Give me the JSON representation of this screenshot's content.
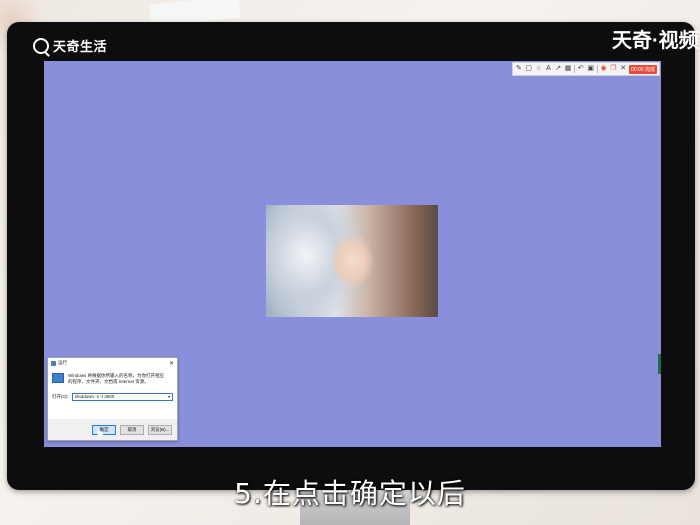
{
  "watermark": {
    "left_brand": "天奇生活",
    "right_brand": "天奇·视频"
  },
  "screen": {
    "background_color": "#8a8fdc",
    "toolbar": {
      "icons": [
        "pen-icon",
        "rectangle-icon",
        "circle-icon",
        "text-icon",
        "arrow-icon",
        "mosaic-icon",
        "undo-icon",
        "save-icon",
        "pin-icon",
        "copy-icon",
        "close-icon"
      ],
      "done_label": "00:00 完成"
    },
    "photo": {
      "description_icon": "image-icon"
    }
  },
  "run_dialog": {
    "title": "运行",
    "description": "Windows 将根据你所输入的名称，为你打开相应的程序、文件夹、文档或 Internet 资源。",
    "open_label": "打开(O):",
    "command_value": "shutdown -s -t 3600",
    "ok_label": "确定",
    "cancel_label": "取消",
    "browse_label": "浏览(B)..."
  },
  "subtitle": "5.在点击确定以后"
}
